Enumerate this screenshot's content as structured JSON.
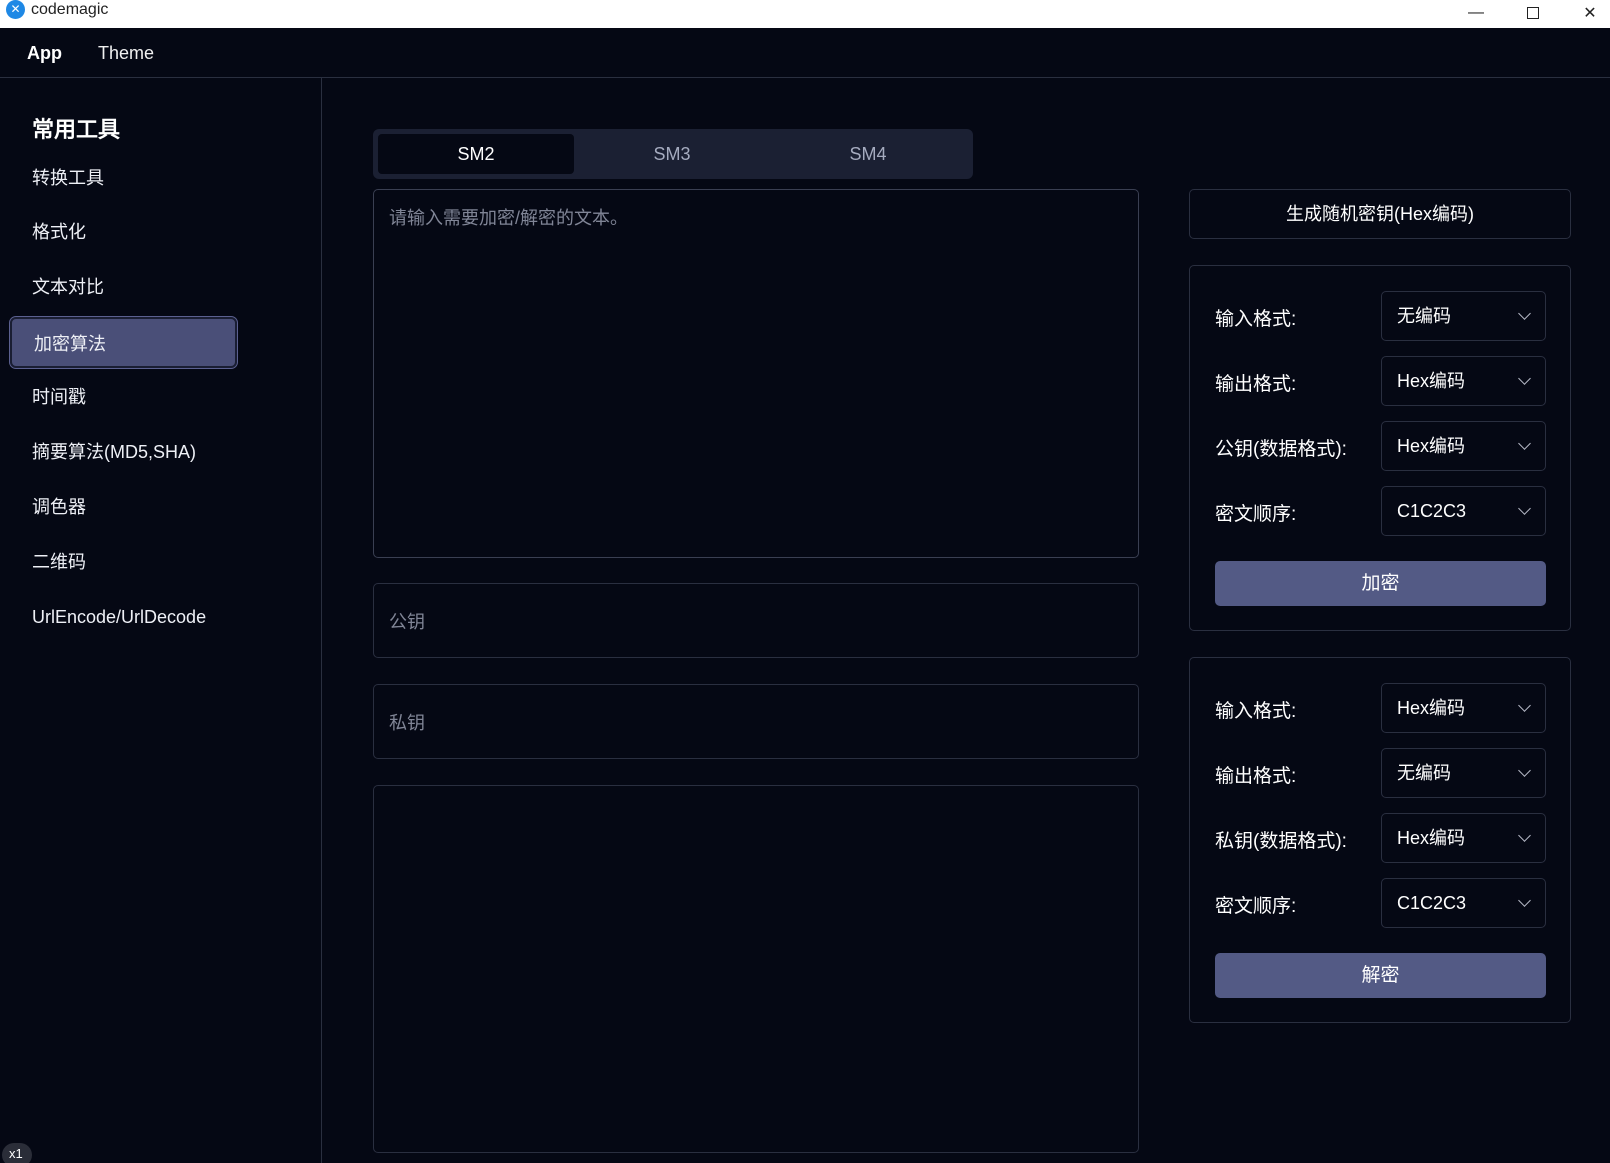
{
  "window": {
    "title": "codemagic",
    "app_icon_glyph": "✕",
    "minimize_glyph": "—",
    "close_glyph": "✕"
  },
  "menu": {
    "app": "App",
    "theme": "Theme"
  },
  "sidebar": {
    "heading": "常用工具",
    "items": [
      {
        "label": "转换工具"
      },
      {
        "label": "格式化"
      },
      {
        "label": "文本对比"
      },
      {
        "label": "加密算法",
        "active": true
      },
      {
        "label": "时间戳"
      },
      {
        "label": "摘要算法(MD5,SHA)"
      },
      {
        "label": "调色器"
      },
      {
        "label": "二维码"
      },
      {
        "label": "UrlEncode/UrlDecode"
      }
    ],
    "badge": "x1"
  },
  "tabs": [
    {
      "label": "SM2",
      "active": true
    },
    {
      "label": "SM3"
    },
    {
      "label": "SM4"
    }
  ],
  "main": {
    "input_placeholder": "请输入需要加密/解密的文本。",
    "public_key_placeholder": "公钥",
    "private_key_placeholder": "私钥",
    "output_value": ""
  },
  "right": {
    "generate_button": "生成随机密钥(Hex编码)",
    "encrypt_panel": {
      "rows": [
        {
          "label": "输入格式:",
          "value": "无编码"
        },
        {
          "label": "输出格式:",
          "value": "Hex编码"
        },
        {
          "label": "公钥(数据格式):",
          "value": "Hex编码"
        },
        {
          "label": "密文顺序:",
          "value": "C1C2C3"
        }
      ],
      "button": "加密"
    },
    "decrypt_panel": {
      "rows": [
        {
          "label": "输入格式:",
          "value": "Hex编码"
        },
        {
          "label": "输出格式:",
          "value": "无编码"
        },
        {
          "label": "私钥(数据格式):",
          "value": "Hex编码"
        },
        {
          "label": "密文顺序:",
          "value": "C1C2C3"
        }
      ],
      "button": "解密"
    }
  }
}
